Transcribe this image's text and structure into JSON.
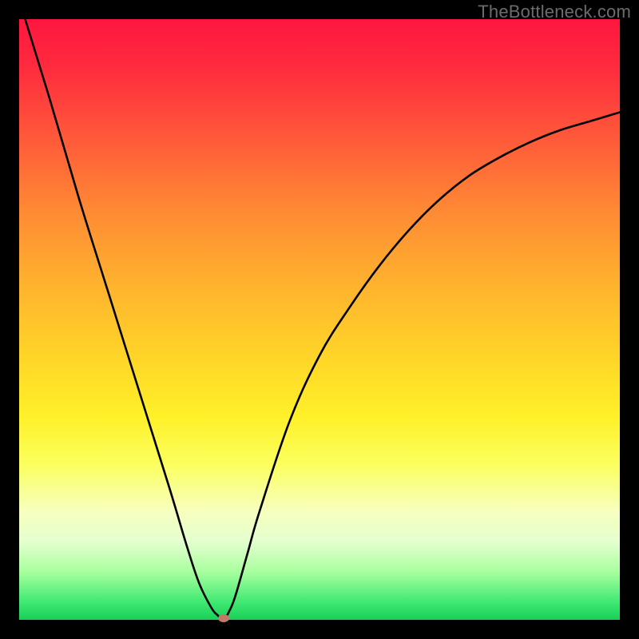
{
  "watermark_text": "TheBottleneck.com",
  "chart_data": {
    "type": "line",
    "title": "",
    "xlabel": "",
    "ylabel": "",
    "xlim": [
      0,
      100
    ],
    "ylim": [
      0,
      100
    ],
    "grid": false,
    "legend": false,
    "series": [
      {
        "name": "curve",
        "color": "#000000",
        "x": [
          1,
          5,
          10,
          15,
          20,
          25,
          28,
          30,
          32,
          33,
          34,
          35,
          36,
          38,
          40,
          45,
          50,
          55,
          60,
          65,
          70,
          75,
          80,
          85,
          90,
          95,
          100
        ],
        "y": [
          100,
          87,
          70,
          54,
          38,
          22,
          12,
          6,
          2,
          0.8,
          0,
          1.5,
          4,
          11,
          18,
          33,
          44,
          52,
          59,
          65,
          70,
          74,
          77,
          79.5,
          81.5,
          83,
          84.5
        ]
      }
    ],
    "minimum_marker": {
      "x": 34,
      "y": 0
    },
    "background_gradient": {
      "direction": "vertical",
      "stops": [
        {
          "pos": 0.0,
          "color": "#ff163f"
        },
        {
          "pos": 0.32,
          "color": "#ff8a34"
        },
        {
          "pos": 0.56,
          "color": "#ffd428"
        },
        {
          "pos": 0.82,
          "color": "#f7ffbf"
        },
        {
          "pos": 1.0,
          "color": "#18cf58"
        }
      ]
    }
  }
}
